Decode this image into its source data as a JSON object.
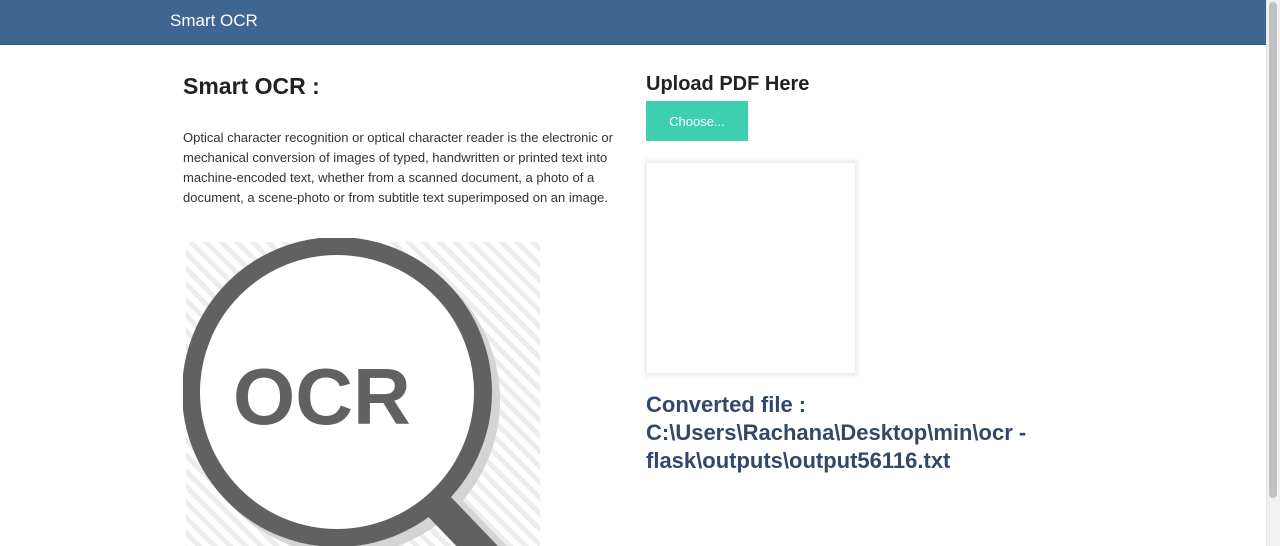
{
  "navbar": {
    "brand": "Smart OCR"
  },
  "intro": {
    "title": "Smart OCR :",
    "description": "Optical character recognition or optical character reader is the electronic or mechanical conversion of images of typed, handwritten or printed text into machine-encoded text, whether from a scanned document, a photo of a document, a scene-photo or from subtitle text superimposed on an image."
  },
  "illustration": {
    "text": "OCR",
    "icon": "magnifying-glass-icon",
    "color": "#616161"
  },
  "upload": {
    "heading": "Upload PDF Here",
    "button_label": "Choose...",
    "button_color": "#3ecfae"
  },
  "result": {
    "text": "Converted file : C:\\Users\\Rachana\\Desktop\\min\\ocr - flask\\outputs\\output56116.txt"
  },
  "theme": {
    "navbar_color": "#3e6690",
    "result_color": "#33476a"
  }
}
